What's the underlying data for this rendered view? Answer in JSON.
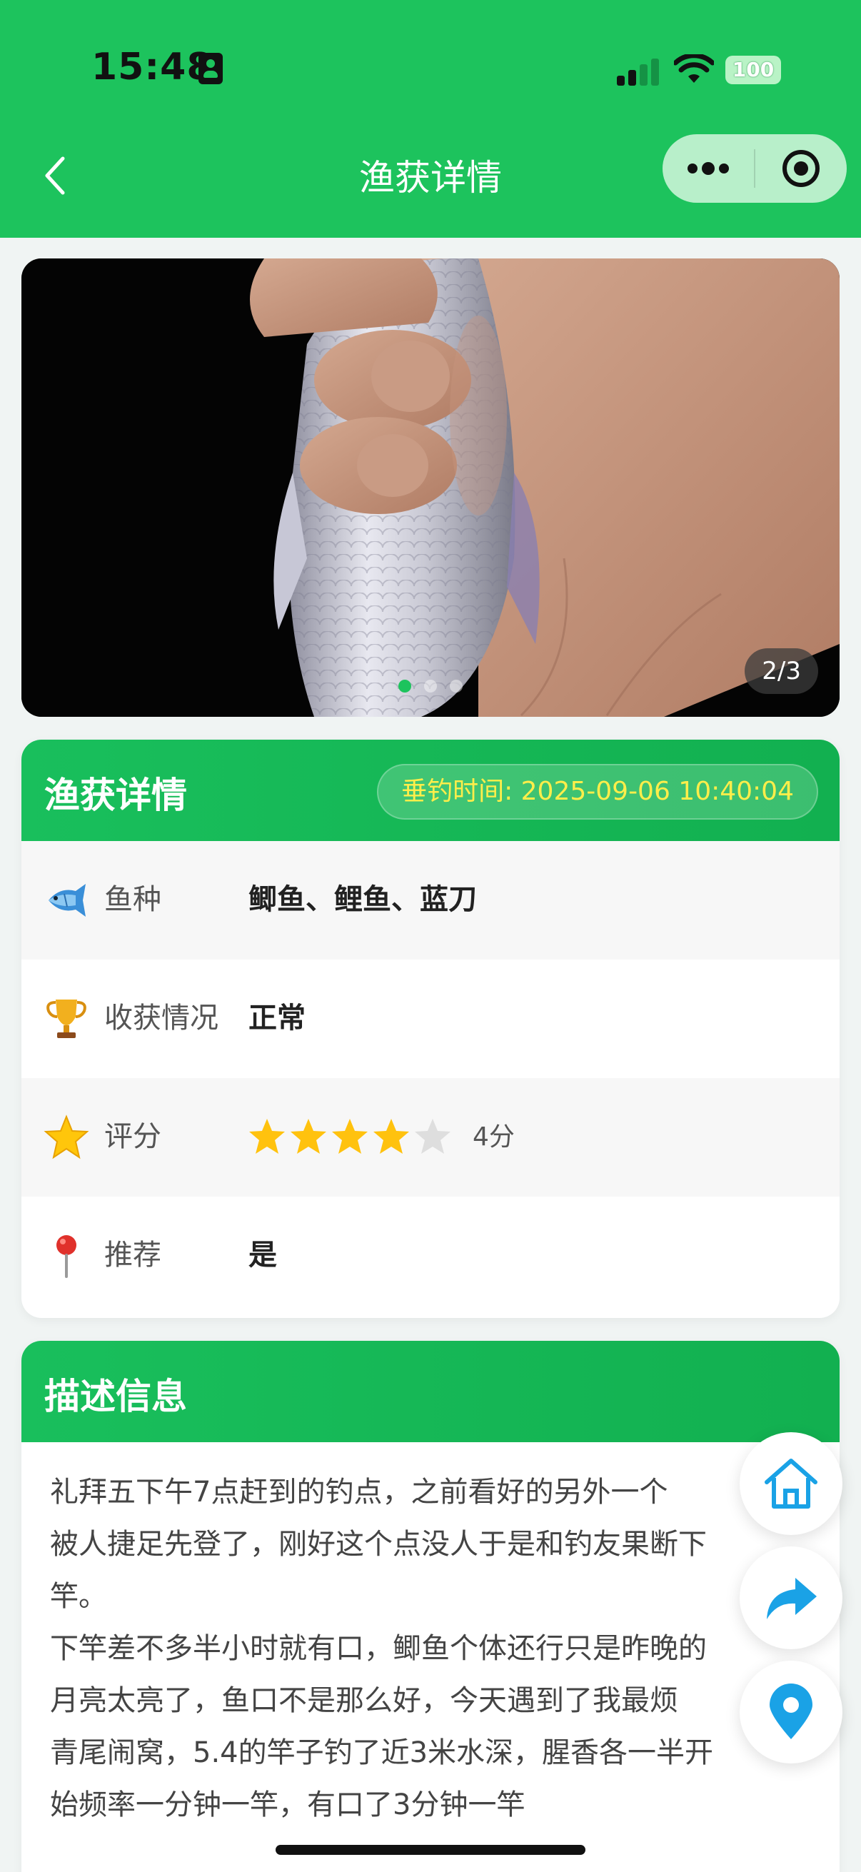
{
  "status_bar": {
    "time": "15:48",
    "battery": "100"
  },
  "nav": {
    "title": "渔获详情",
    "back_icon": "chevron-left-icon",
    "more_icon": "more-dots-icon",
    "close_icon": "target-close-icon"
  },
  "carousel": {
    "counter": "2/3",
    "current_index": 2,
    "total": 3
  },
  "detail": {
    "title": "渔获详情",
    "fishing_time": "垂钓时间: 2025-09-06 10:40:04",
    "rows": [
      {
        "icon": "fish-icon",
        "label": "鱼种",
        "value": "鲫鱼、鲤鱼、蓝刀"
      },
      {
        "icon": "trophy-icon",
        "label": "收获情况",
        "value": "正常"
      },
      {
        "icon": "star-icon",
        "label": "评分",
        "rating": 4,
        "max_rating": 5,
        "score_text": "4分"
      },
      {
        "icon": "pin-icon",
        "label": "推荐",
        "value": "是"
      }
    ]
  },
  "description": {
    "title": "描述信息",
    "text": "礼拜五下午7点赶到的钓点，之前看好的另外一个\n被人捷足先登了，刚好这个点没人于是和钓友果断下\n竿。\n下竿差不多半小时就有口，鲫鱼个体还行只是昨晚的\n月亮太亮了，鱼口不是那么好，今天遇到了我最烦\n青尾闹窝，5.4的竿子钓了近3米水深，腥香各一半开\n始频率一分钟一竿，有口了3分钟一竿"
  },
  "fabs": [
    {
      "icon": "home-icon"
    },
    {
      "icon": "share-icon"
    },
    {
      "icon": "location-icon"
    }
  ],
  "colors": {
    "brand_green": "#1dc35d",
    "time_yellow": "#ffee4a",
    "star_gold": "#ffc20e",
    "fab_blue": "#1aa2e6"
  }
}
